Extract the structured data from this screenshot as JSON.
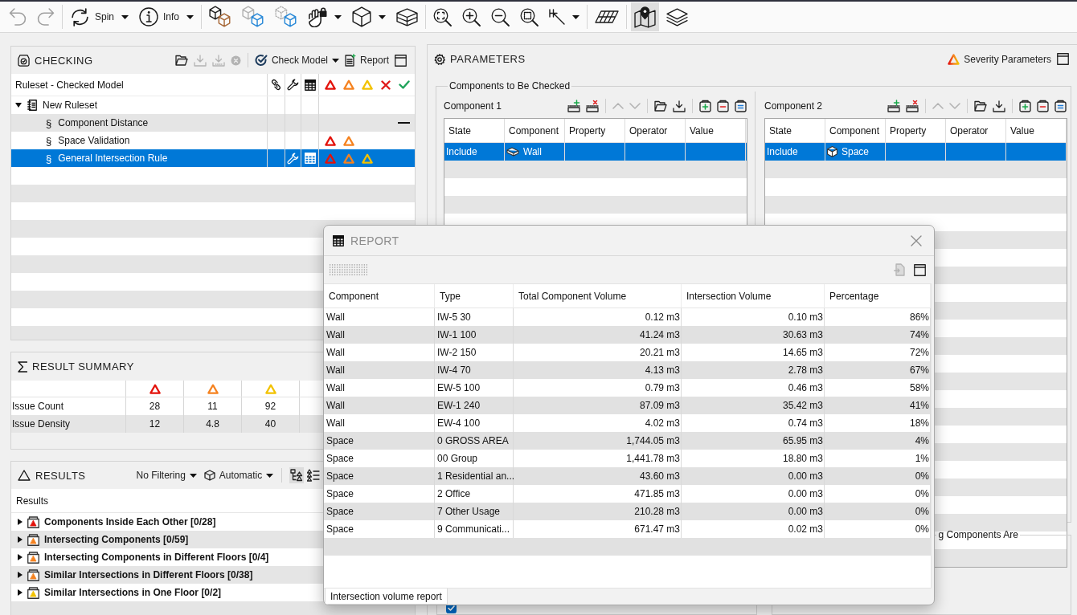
{
  "toolbar": [
    [
      {
        "disabled": true,
        "pressed": false,
        "dropdown": false
      },
      {
        "disabled": true,
        "pressed": false,
        "dropdown": false
      }
    ],
    [
      {
        "label": "Spin",
        "disabled": false,
        "pressed": false,
        "dropdown": true
      },
      {
        "label": "Info",
        "disabled": false,
        "pressed": false,
        "dropdown": true
      }
    ],
    [
      {
        "disabled": false,
        "pressed": false,
        "dropdown": false
      },
      {
        "disabled": false,
        "pressed": false,
        "dropdown": false
      },
      {
        "disabled": false,
        "pressed": false,
        "dropdown": false
      },
      {
        "disabled": false,
        "pressed": false,
        "dropdown": true
      },
      {
        "disabled": false,
        "pressed": false,
        "dropdown": true
      },
      {
        "disabled": false,
        "pressed": false,
        "dropdown": false
      }
    ],
    [
      {
        "disabled": false,
        "pressed": false,
        "dropdown": false
      },
      {
        "disabled": false,
        "pressed": false,
        "dropdown": false
      },
      {
        "disabled": false,
        "pressed": false,
        "dropdown": false
      },
      {
        "disabled": false,
        "pressed": false,
        "dropdown": false
      },
      {
        "disabled": false,
        "pressed": false,
        "dropdown": true
      }
    ],
    [
      {
        "disabled": false,
        "pressed": false,
        "dropdown": false
      }
    ],
    [
      {
        "disabled": false,
        "pressed": true,
        "dropdown": false
      },
      {
        "disabled": false,
        "pressed": false,
        "dropdown": false
      }
    ]
  ],
  "checking": {
    "title": "CHECKING",
    "actions": [
      {
        "disabled": false,
        "dropdown": false
      },
      {
        "disabled": true,
        "dropdown": false
      },
      {
        "disabled": true,
        "dropdown": false
      },
      {
        "disabled": true,
        "dropdown": false
      },
      {
        "label": "Check Model",
        "disabled": false,
        "dropdown": true
      },
      {
        "label": "Report",
        "disabled": false,
        "dropdown": false
      }
    ],
    "tree": {
      "column": "Ruleset - Checked Model",
      "rows": [
        {
          "label": "New Ruleset",
          "kind": "ruleset",
          "expanded": true,
          "selected": false,
          "children": [
            {
              "symbol": "§",
              "label": "Component Distance",
              "kind": "rule",
              "selected": false,
              "settings": false,
              "report": false,
              "unchecked": true
            },
            {
              "symbol": "§",
              "label": "Space Validation",
              "kind": "rule",
              "selected": false,
              "settings": false,
              "report": false,
              "unchecked": false,
              "issues": [
                {
                  "kind": "critical"
                },
                {
                  "kind": "major"
                }
              ]
            },
            {
              "symbol": "§",
              "label": "General Intersection Rule",
              "kind": "rule",
              "selected": true,
              "settings": true,
              "report": true,
              "unchecked": false,
              "issues": [
                {
                  "kind": "critical"
                },
                {
                  "kind": "major"
                },
                {
                  "kind": "minor"
                }
              ]
            }
          ]
        }
      ]
    }
  },
  "parameters": {
    "title": "PARAMETERS",
    "severity_button": "Severity Parameters",
    "group": {
      "legend": "Components to Be Checked",
      "panels": [
        {
          "title": "Component 1",
          "tools": [
            {
              "disabled": false
            },
            {
              "disabled": false
            },
            {
              "disabled": true
            },
            {
              "disabled": true
            },
            {
              "disabled": false
            },
            {
              "disabled": false
            },
            {
              "disabled": false
            },
            {
              "disabled": false
            },
            {
              "disabled": false
            }
          ],
          "columns": [
            "State",
            "Component",
            "Property",
            "Operator",
            "Value"
          ],
          "rows": [
            {
              "state": "Include",
              "component": "Wall",
              "kind": "wall",
              "selected": true
            }
          ]
        },
        {
          "title": "Component 2",
          "tools": [
            {
              "disabled": false
            },
            {
              "disabled": false
            },
            {
              "disabled": true
            },
            {
              "disabled": true
            },
            {
              "disabled": false
            },
            {
              "disabled": false
            },
            {
              "disabled": false
            },
            {
              "disabled": false
            },
            {
              "disabled": false
            }
          ],
          "columns": [
            "State",
            "Component",
            "Property",
            "Operator",
            "Value"
          ],
          "rows": [
            {
              "state": "Include",
              "component": "Space",
              "kind": "space",
              "selected": true
            }
          ]
        }
      ]
    },
    "lower_groups": [
      {
        "checkbox": {
          "checked": true
        }
      },
      {
        "legend": "g Components Are"
      }
    ]
  },
  "result_summary": {
    "title": "RESULT SUMMARY",
    "rows": [
      {
        "label": "Issue Count",
        "values": [
          "28",
          "11",
          "92"
        ]
      },
      {
        "label": "Issue Density",
        "values": [
          "12",
          "4.8",
          "40"
        ]
      }
    ]
  },
  "results": {
    "title": "RESULTS",
    "filter": "No Filtering",
    "mode": "Automatic",
    "views": [
      {
        "pressed": true
      },
      {
        "pressed": false
      }
    ],
    "tree": {
      "header": "Results",
      "items": [
        {
          "label": "Components Inside Each Other [0/28]",
          "kind": "critical",
          "expanded": false
        },
        {
          "label": "Intersecting Components [0/59]",
          "kind": "major",
          "expanded": false
        },
        {
          "label": "Intersecting Components in Different Floors [0/4]",
          "kind": "major",
          "expanded": false
        },
        {
          "label": "Similar Intersections in Different Floors [0/38]",
          "kind": "major",
          "expanded": false
        },
        {
          "label": "Similar Intersections in One Floor [0/2]",
          "kind": "minor",
          "expanded": false
        }
      ]
    }
  },
  "report": {
    "title": "REPORT",
    "tools": [
      {
        "disabled": true
      },
      {
        "disabled": false
      }
    ],
    "columns": [
      "Component",
      "Type",
      "Total Component Volume",
      "Intersection Volume",
      "Percentage"
    ],
    "rows": [
      [
        "Wall",
        "IW-5 30",
        "0.12 m3",
        "0.10 m3",
        "86%"
      ],
      [
        "Wall",
        "IW-1 100",
        "41.24 m3",
        "30.63 m3",
        "74%"
      ],
      [
        "Wall",
        "IW-2 150",
        "20.21 m3",
        "14.65 m3",
        "72%"
      ],
      [
        "Wall",
        "IW-4 70",
        "4.13 m3",
        "2.78 m3",
        "67%"
      ],
      [
        "Wall",
        "EW-5 100",
        "0.79 m3",
        "0.46 m3",
        "58%"
      ],
      [
        "Wall",
        "EW-1 240",
        "87.09 m3",
        "35.42 m3",
        "41%"
      ],
      [
        "Wall",
        "EW-4 100",
        "4.02 m3",
        "0.74 m3",
        "18%"
      ],
      [
        "Space",
        "0 GROSS AREA",
        "1,744.05 m3",
        "65.95 m3",
        "4%"
      ],
      [
        "Space",
        "00 Group",
        "1,441.78 m3",
        "18.80 m3",
        "1%"
      ],
      [
        "Space",
        "1 Residential an...",
        "43.60 m3",
        "0.00 m3",
        "0%"
      ],
      [
        "Space",
        "2 Office",
        "471.85 m3",
        "0.00 m3",
        "0%"
      ],
      [
        "Space",
        "7 Other Usage",
        "210.28 m3",
        "0.00 m3",
        "0%"
      ],
      [
        "Space",
        "9 Communicati...",
        "671.47 m3",
        "0.02 m3",
        "0%"
      ]
    ],
    "tabs": [
      {
        "label": "Intersection volume report",
        "selected": true
      }
    ]
  }
}
